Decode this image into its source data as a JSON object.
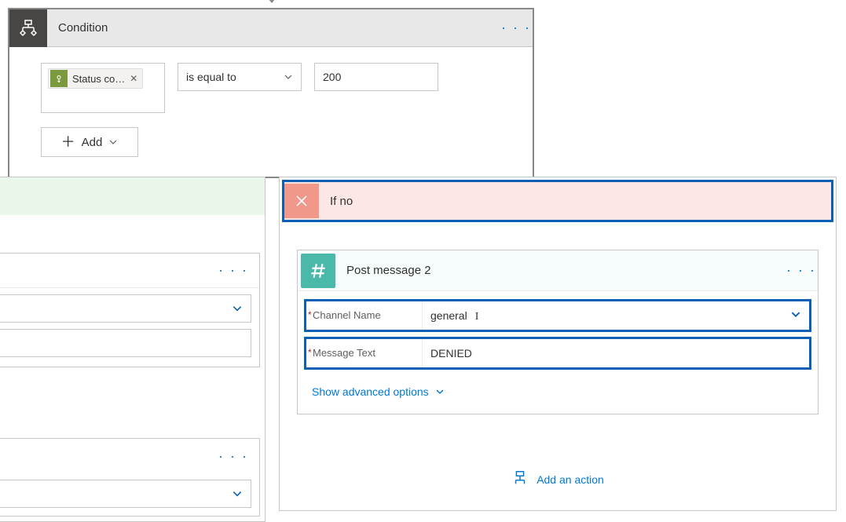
{
  "condition": {
    "title": "Condition",
    "token_label": "Status co…",
    "operator": "is equal to",
    "value": "200",
    "add_label": "Add"
  },
  "ifno": {
    "title": "If no",
    "post_message": {
      "title": "Post message 2",
      "channel_label": "Channel Name",
      "channel_value": "general",
      "message_label": "Message Text",
      "message_value": "DENIED",
      "advanced_label": "Show advanced options"
    },
    "add_action_label": "Add an action"
  }
}
